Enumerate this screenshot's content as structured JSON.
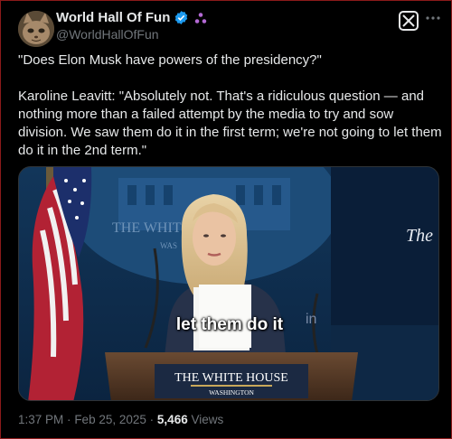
{
  "author": {
    "name": "World Hall Of Fun",
    "handle": "@WorldHallOfFun"
  },
  "tweet": {
    "question": "\"Does Elon Musk have powers of the presidency?\"",
    "answer": "Karoline Leavitt: \"Absolutely not. That's a ridiculous question — and nothing more than a failed attempt by the media to try and sow division. We saw them do it in the first term; we're not going to let them do it in the 2nd term.\""
  },
  "media": {
    "caption": "let them do it",
    "backdrop_text": "THE WHITE HOUSE",
    "backdrop_sub": "WAS",
    "side_text": "The",
    "in_text": "in",
    "podium_title": "THE WHITE HOUSE",
    "podium_subtitle": "WASHINGTON"
  },
  "meta": {
    "time": "1:37 PM",
    "separator": "·",
    "date": "Feb 25, 2025",
    "views_count": "5,466",
    "views_label": "Views"
  },
  "icons": {
    "verified": "verified-badge-icon",
    "affiliate": "affiliate-icon",
    "more": "more-options-icon",
    "x_logo": "x-logo-icon"
  },
  "colors": {
    "verified": "#1d9bf0",
    "affiliate": "#b56ad6",
    "background": "#000000",
    "muted": "#71767b"
  }
}
